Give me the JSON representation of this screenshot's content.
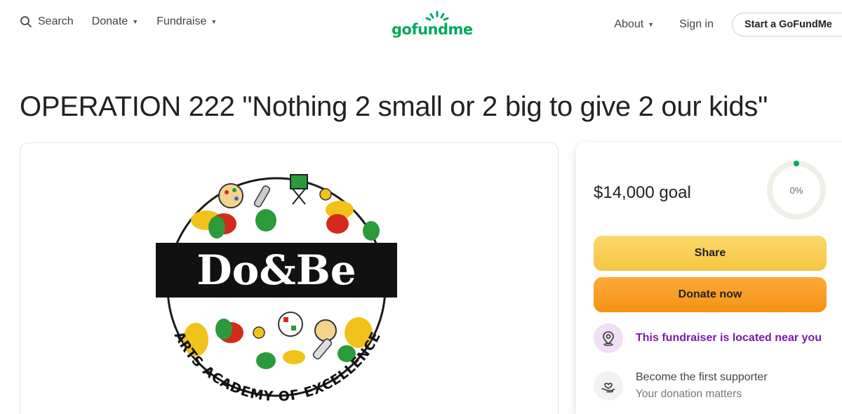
{
  "header": {
    "search_label": "Search",
    "donate_label": "Donate",
    "fundraise_label": "Fundraise",
    "logo_text": "gofundme",
    "about_label": "About",
    "signin_label": "Sign in",
    "start_label": "Start a GoFundMe"
  },
  "campaign": {
    "title": "OPERATION 222 \"Nothing 2 small or 2 big to give 2 our kids\"",
    "image": {
      "banner_text": "Do&Be",
      "ring_text": "ARTS ACADEMY OF EXCELLENCE"
    }
  },
  "donation_panel": {
    "goal": "$14,000 goal",
    "progress_percent": "0%",
    "progress_fraction": 0,
    "share_label": "Share",
    "donate_label": "Donate now",
    "location_note": "This fundraiser is located near you",
    "supporter_title": "Become the first supporter",
    "supporter_sub": "Your donation matters"
  },
  "colors": {
    "brand_green": "#02a95c",
    "share_yellow": "#f6c545",
    "donate_orange": "#f59314",
    "location_purple": "#7a1aa8"
  },
  "icons": [
    "search-icon",
    "chevron-down-icon",
    "location-pin-icon",
    "heart-hand-icon"
  ]
}
